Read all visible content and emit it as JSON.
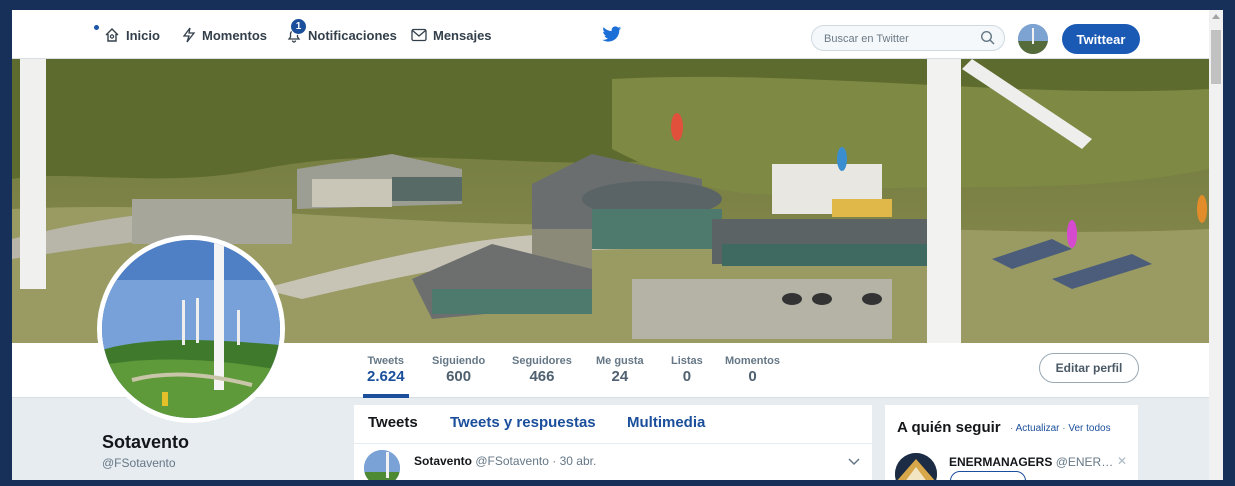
{
  "nav": {
    "home": "Inicio",
    "moments": "Momentos",
    "notifications": "Notificaciones",
    "notifications_count": "1",
    "messages": "Mensajes",
    "search_placeholder": "Buscar en Twitter",
    "tweet_button": "Twittear",
    "accent_color": "#1b5ab4"
  },
  "profile_nav": {
    "stats": [
      {
        "label": "Tweets",
        "value": "2.624"
      },
      {
        "label": "Siguiendo",
        "value": "600"
      },
      {
        "label": "Seguidores",
        "value": "466"
      },
      {
        "label": "Me gusta",
        "value": "24"
      },
      {
        "label": "Listas",
        "value": "0"
      },
      {
        "label": "Momentos",
        "value": "0"
      }
    ],
    "edit_profile": "Editar perfil"
  },
  "profile": {
    "name": "Sotavento",
    "handle": "@FSotavento"
  },
  "timeline": {
    "tabs": [
      "Tweets",
      "Tweets y respuestas",
      "Multimedia"
    ],
    "tweet": {
      "author": "Sotavento",
      "handle": "@FSotavento",
      "date": "· 30 abr."
    }
  },
  "who_to_follow": {
    "title": "A quién seguir",
    "sep": " · ",
    "refresh": "Actualizar",
    "view_all": "Ver todos",
    "user": {
      "name": "ENERMANAGERS",
      "handle": "@ENER…"
    }
  }
}
